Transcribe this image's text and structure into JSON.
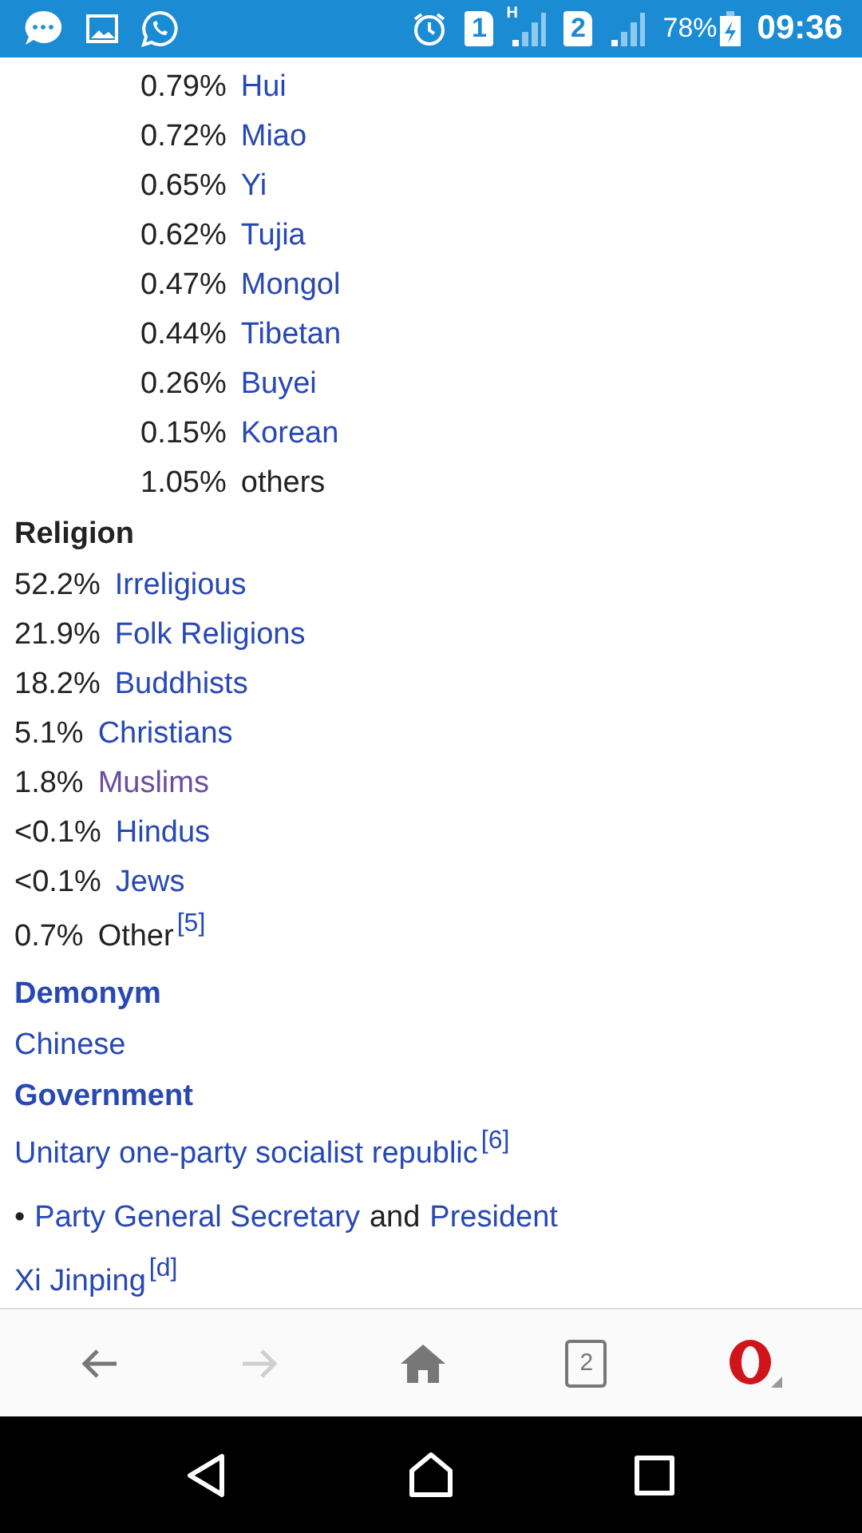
{
  "status_bar": {
    "sim_slots": [
      "1",
      "2"
    ],
    "network_type": "H",
    "battery": "78%",
    "time": "09:36"
  },
  "ethnic_groups": [
    {
      "percent": "0.79%",
      "name": "Hui",
      "kind": "link"
    },
    {
      "percent": "0.72%",
      "name": "Miao",
      "kind": "link"
    },
    {
      "percent": "0.65%",
      "name": "Yi",
      "kind": "link"
    },
    {
      "percent": "0.62%",
      "name": "Tujia",
      "kind": "link"
    },
    {
      "percent": "0.47%",
      "name": "Mongol",
      "kind": "link"
    },
    {
      "percent": "0.44%",
      "name": "Tibetan",
      "kind": "link"
    },
    {
      "percent": "0.26%",
      "name": "Buyei",
      "kind": "link"
    },
    {
      "percent": "0.15%",
      "name": "Korean",
      "kind": "link"
    },
    {
      "percent": "1.05%",
      "name": "others",
      "kind": "plain"
    }
  ],
  "religion": {
    "heading": {
      "text": "Religion",
      "kind": "plain"
    },
    "items": [
      {
        "percent": "52.2%",
        "name": "Irreligious",
        "kind": "link"
      },
      {
        "percent": "21.9%",
        "name": "Folk Religions",
        "kind": "link"
      },
      {
        "percent": "18.2%",
        "name": "Buddhists",
        "kind": "link"
      },
      {
        "percent": "5.1%",
        "name": "Christians",
        "kind": "link"
      },
      {
        "percent": "1.8%",
        "name": "Muslims",
        "kind": "visited"
      },
      {
        "percent": "<0.1%",
        "name": "Hindus",
        "kind": "link"
      },
      {
        "percent": "<0.1%",
        "name": "Jews",
        "kind": "link"
      },
      {
        "percent": "0.7%",
        "name": "Other",
        "kind": "plain",
        "ref": "[5]"
      }
    ]
  },
  "demonym": {
    "heading": {
      "text": "Demonym",
      "kind": "link"
    },
    "value": {
      "text": "Chinese",
      "kind": "link"
    }
  },
  "government": {
    "heading": {
      "text": "Government",
      "kind": "link"
    },
    "lines": [
      [
        {
          "text": "Unitary one-party socialist republic",
          "kind": "link",
          "ref": "[6]"
        }
      ],
      [
        {
          "text": "•",
          "kind": "plain"
        },
        {
          "text": "Party General Secretary",
          "kind": "link"
        },
        {
          "text": "and",
          "kind": "plain"
        },
        {
          "text": "President",
          "kind": "link"
        }
      ],
      [
        {
          "text": "Xi Jinping",
          "kind": "link",
          "ref": "[d]"
        }
      ]
    ]
  },
  "browser_bar": {
    "back_disabled": false,
    "forward_disabled": true,
    "tab_count": "2"
  }
}
